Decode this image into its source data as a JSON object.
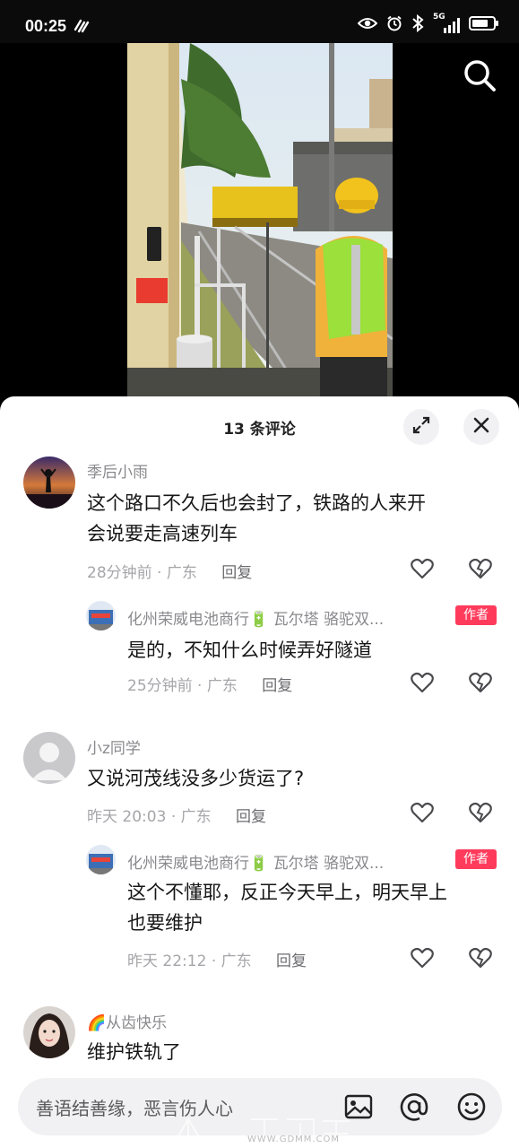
{
  "status_bar": {
    "time": "00:25",
    "network": "5G"
  },
  "sheet": {
    "title": "13 条评论"
  },
  "comments": [
    {
      "user": "季后小雨",
      "text_line1": "这个路口不久后也会封了，铁路的人来开",
      "text_line2": "会说要走高速列车",
      "time": "28分钟前",
      "location": "广东",
      "reply": "回复"
    },
    {
      "user": "化州荣威电池商行🔋 瓦尔塔 骆驼双...",
      "author_tag": "作者",
      "text_line1": "是的，不知什么时候弄好隧道",
      "time": "25分钟前",
      "location": "广东",
      "reply": "回复"
    },
    {
      "user": "小z同学",
      "text_line1": "又说河茂线没多少货运了?",
      "time": "昨天 20:03",
      "location": "广东",
      "reply": "回复"
    },
    {
      "user": "化州荣威电池商行🔋 瓦尔塔 骆驼双...",
      "author_tag": "作者",
      "text_line1": "这个不懂耶，反正今天早上，明天早上",
      "text_line2": "也要维护",
      "time": "昨天 22:12",
      "location": "广东",
      "reply": "回复"
    },
    {
      "user": "🌈从齿快乐",
      "text_line1": "维护铁轨了"
    }
  ],
  "input": {
    "placeholder": "善语结善缘，恶言伤人心"
  },
  "watermark": {
    "url": "WWW.GDMM.COM"
  },
  "colors": {
    "author_tag": "#ff3b5c",
    "sheet_bg": "#ffffff",
    "meta_text": "#a6a6aa"
  }
}
